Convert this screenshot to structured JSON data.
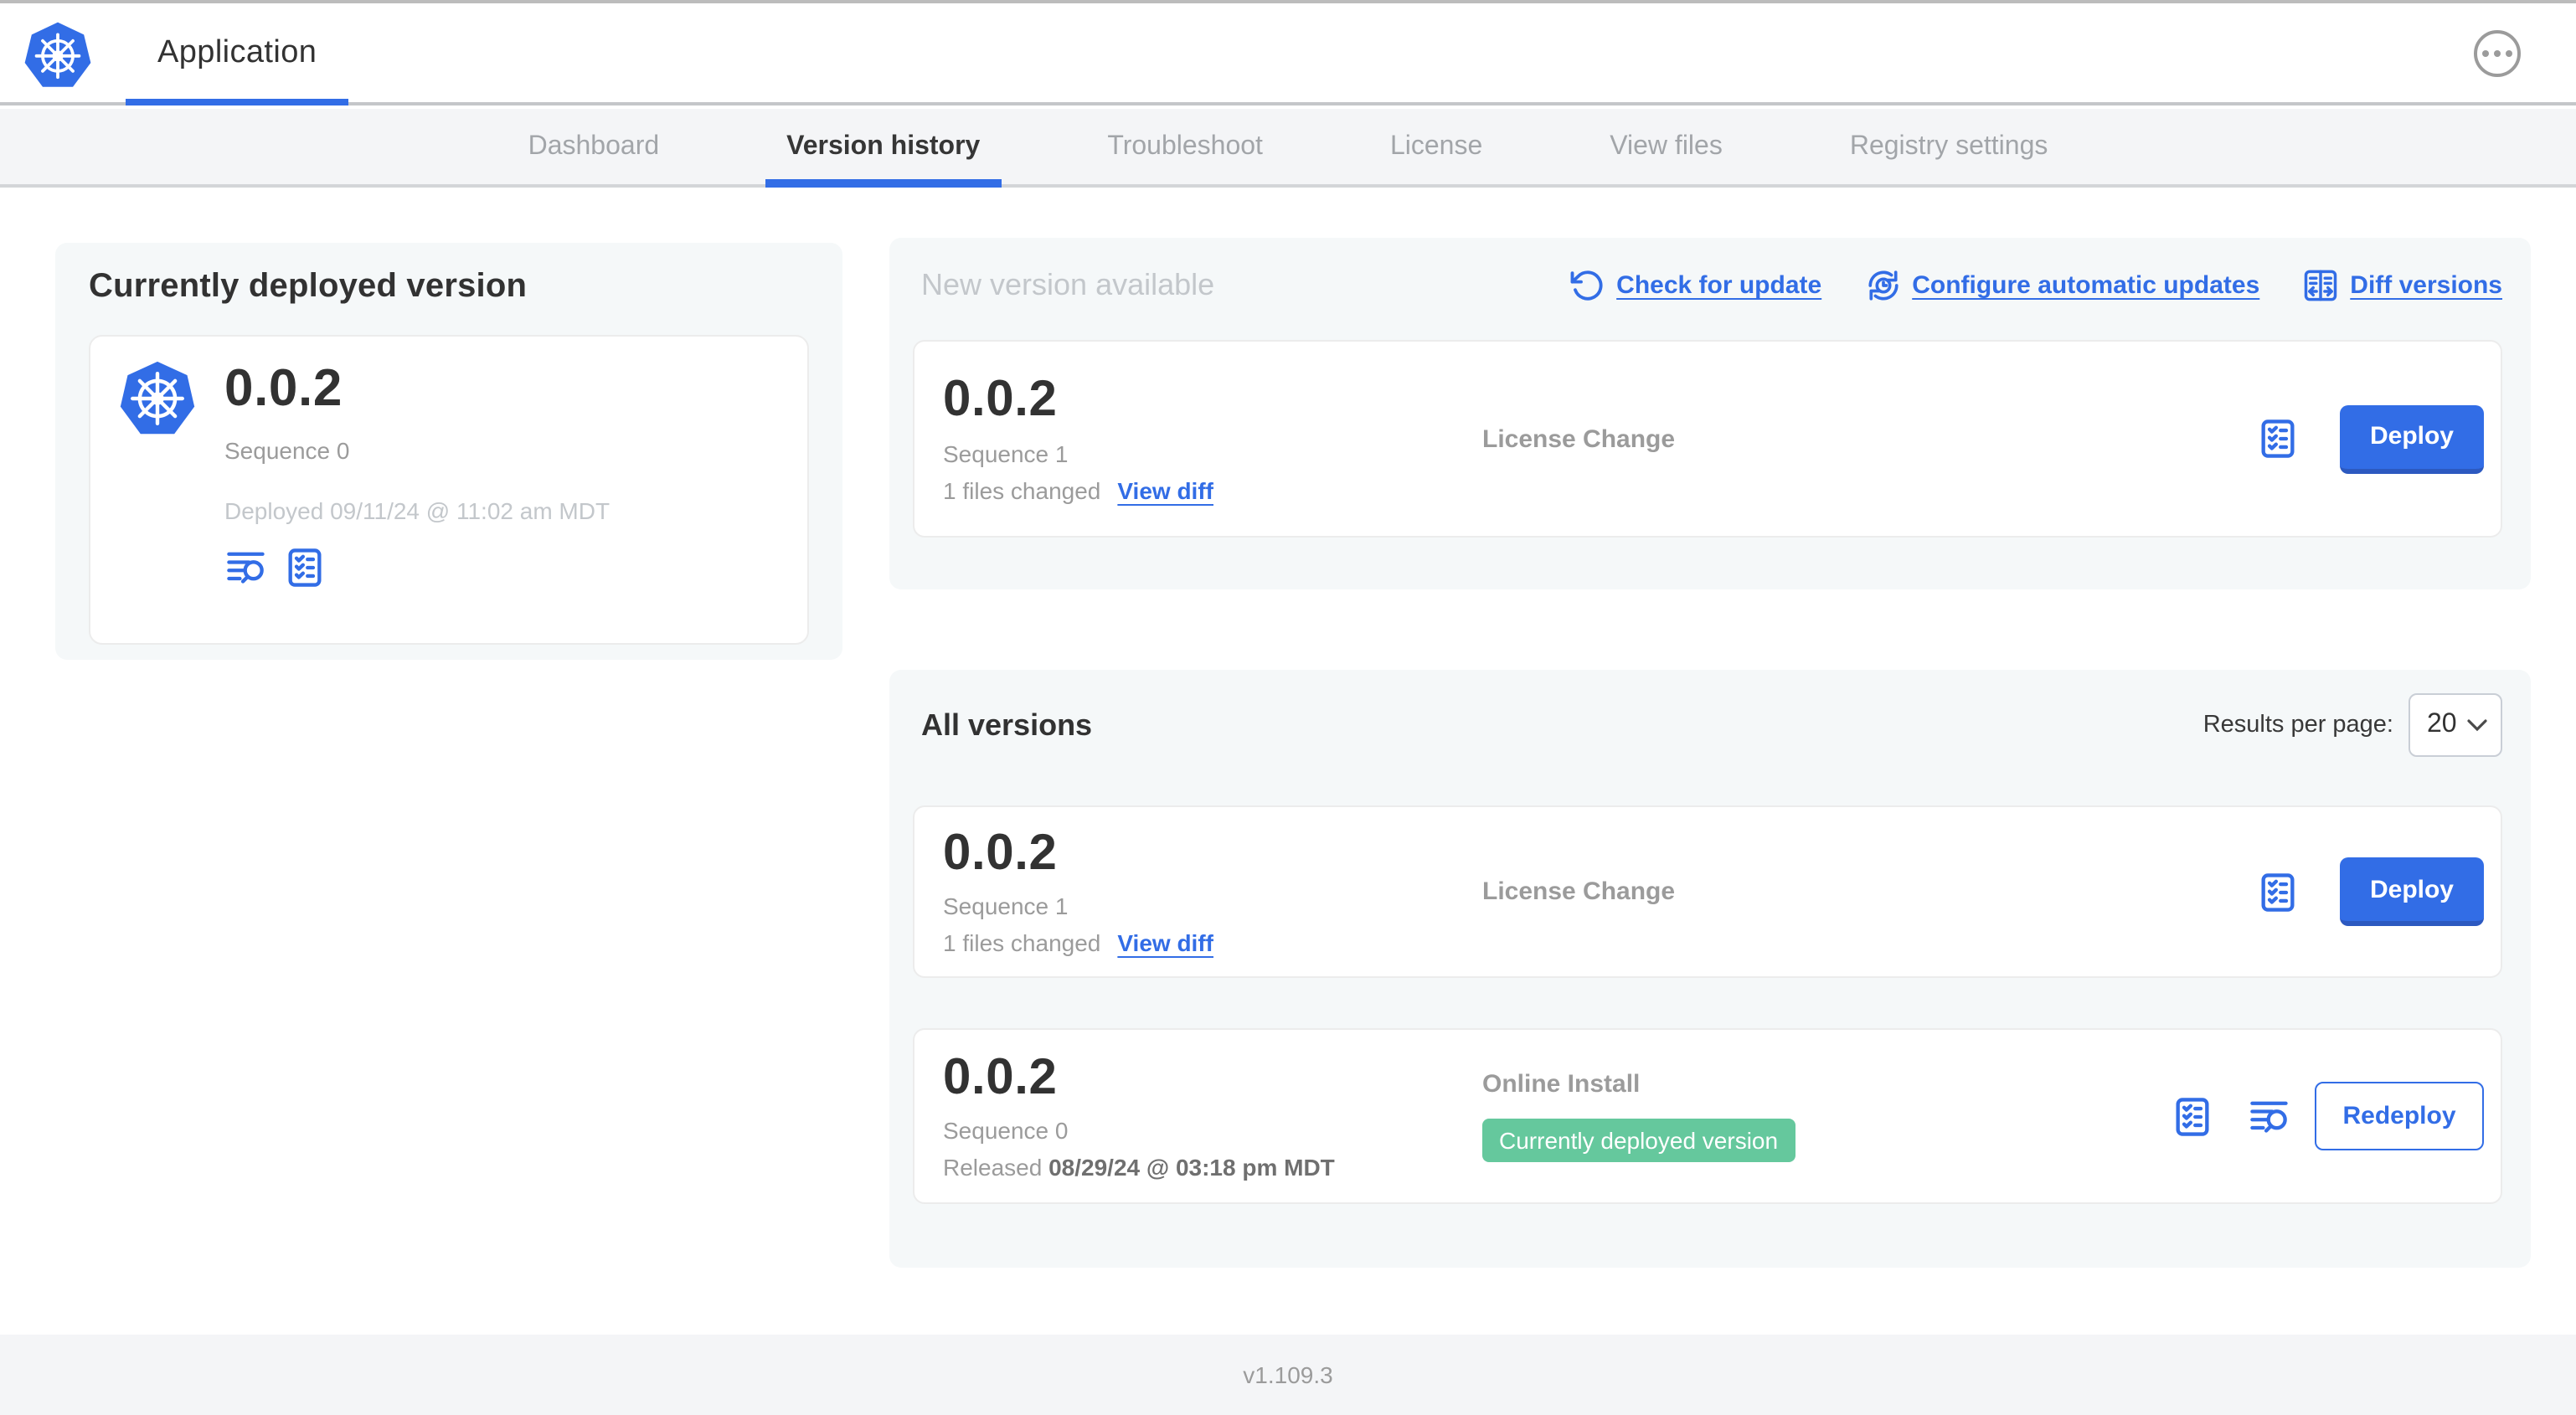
{
  "header": {
    "app_title": "Application"
  },
  "nav": {
    "tabs": [
      {
        "label": "Dashboard",
        "active": false
      },
      {
        "label": "Version history",
        "active": true
      },
      {
        "label": "Troubleshoot",
        "active": false
      },
      {
        "label": "License",
        "active": false
      },
      {
        "label": "View files",
        "active": false
      },
      {
        "label": "Registry settings",
        "active": false
      }
    ]
  },
  "current_deployed": {
    "title": "Currently deployed version",
    "version": "0.0.2",
    "sequence": "Sequence 0",
    "deployed_at": "Deployed 09/11/24 @ 11:02 am MDT"
  },
  "new_version": {
    "title": "New version available",
    "links": {
      "check_for_update": "Check for update",
      "configure_automatic_updates": "Configure automatic updates",
      "diff_versions": "Diff versions"
    },
    "card": {
      "version": "0.0.2",
      "sequence": "Sequence 1",
      "files_changed": "1 files changed",
      "view_diff": "View diff",
      "source": "License Change",
      "action": "Deploy"
    }
  },
  "all_versions": {
    "title": "All versions",
    "results_per_page_label": "Results per page:",
    "results_per_page_value": "20",
    "rows": [
      {
        "version": "0.0.2",
        "sequence": "Sequence 1",
        "files_changed": "1 files changed",
        "view_diff": "View diff",
        "source": "License Change",
        "action": "Deploy"
      },
      {
        "version": "0.0.2",
        "sequence": "Sequence 0",
        "released_prefix": "Released ",
        "released_date": "08/29/24 @ 03:18 pm MDT",
        "source": "Online Install",
        "badge": "Currently deployed version",
        "action": "Redeploy"
      }
    ]
  },
  "footer": {
    "version": "v1.109.3"
  },
  "colors": {
    "accent_blue": "#326de6",
    "button_shadow_blue": "#2c59c0",
    "badge_green": "#65c89d",
    "dark_text": "#323232",
    "gray_text": "#9b9b9b",
    "light_gray_text": "#c3c7cb",
    "panel_bg": "#f5f8f9",
    "nav_bg": "#f4f5f7"
  },
  "icons": {
    "kubernetes-logo": "blue heptagon with white ship wheel",
    "more-icon": "ellipsis in circle",
    "check-update-icon": "counterclockwise refresh arrow",
    "auto-update-icon": "clock with circular arrows",
    "diff-icon": "split pane with outward arrows",
    "checklist-icon": "clipboard with checkmarks",
    "logs-icon": "text lines with magnifier",
    "chevron-down-icon": "v"
  }
}
